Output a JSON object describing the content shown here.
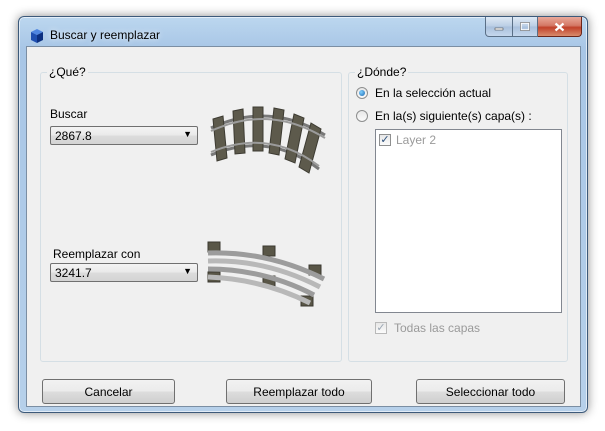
{
  "window": {
    "title": "Buscar y reemplazar"
  },
  "what_group": {
    "title": "¿Qué?",
    "find_label": "Buscar",
    "find_value": "2867.8",
    "replace_label": "Reemplazar con",
    "replace_value": "3241.7"
  },
  "where_group": {
    "title": "¿Dónde?",
    "option_selection": "En la selección actual",
    "option_layers": "En la(s) siguiente(s) capa(s) :",
    "selected_option": "selection",
    "layers": [
      {
        "name": "Layer 2",
        "checked": true
      }
    ],
    "all_layers_label": "Todas las capas",
    "all_layers_checked": true
  },
  "buttons": {
    "cancel": "Cancelar",
    "replace_all": "Reemplazar todo",
    "select_all": "Seleccionar todo"
  },
  "glyphs": {
    "dropdown_arrow": "▼",
    "check": "✓"
  }
}
